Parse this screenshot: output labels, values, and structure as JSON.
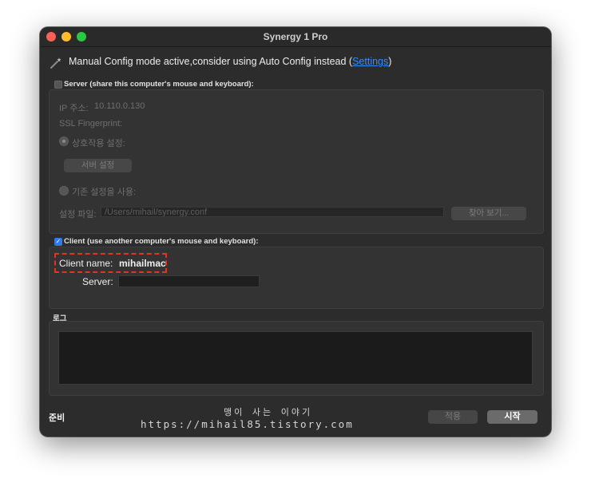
{
  "window": {
    "title": "Synergy 1 Pro"
  },
  "notice": {
    "text": "Manual Config mode active,consider using Auto Config instead (",
    "link": "Settings",
    "suffix": ")"
  },
  "server_group": {
    "label": "Server (share this computer's mouse and keyboard):",
    "checked": false,
    "ip_label": "IP 주소:",
    "ip_value": "10.110.0.130",
    "ssl_label": "SSL Fingerprint:",
    "interactive_label": "상호작용 설정:",
    "server_settings_button": "서버 설정",
    "existing_config_label": "기존 설정을 사용:",
    "config_file_label": "설정 파일:",
    "config_file_path": "/Users/mihail/synergy.conf",
    "browse_button": "찾아 보기..."
  },
  "client_group": {
    "label": "Client (use another computer's mouse and keyboard):",
    "checked": true,
    "client_name_label": "Client name:",
    "client_name_value": "mihailmac",
    "server_label": "Server:",
    "server_value": ""
  },
  "log": {
    "label": "로그"
  },
  "footer": {
    "status": "준비",
    "apply_button": "적용",
    "start_button": "시작"
  },
  "watermark": {
    "line1": "맹이 사는 이야기",
    "line2": "https://mihail85.tistory.com"
  },
  "colors": {
    "accent": "#2b7be8",
    "link": "#3a8cf5",
    "highlight_dashed": "#e0351f"
  }
}
